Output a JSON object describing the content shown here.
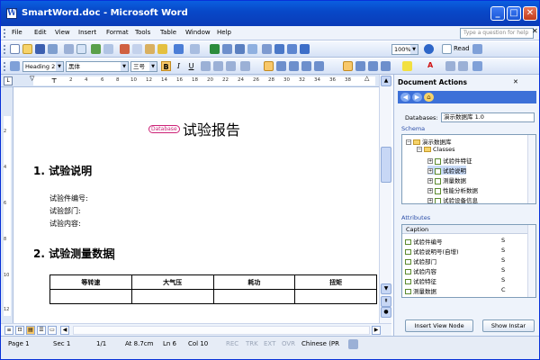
{
  "window": {
    "title": "SmartWord.doc - Microsoft Word",
    "minimize": "_",
    "maximize": "□",
    "close": "✕"
  },
  "menu": {
    "items": [
      "File",
      "Edit",
      "View",
      "Insert",
      "Format",
      "Tools",
      "Table",
      "Window",
      "Help"
    ],
    "help_placeholder": "Type a question for help",
    "close_doc": "✕"
  },
  "toolbar": {
    "zoom": "100%",
    "read_label": "Read",
    "style": "Heading 2",
    "font": "黑体",
    "size": "三号",
    "bold": "B",
    "italic": "I",
    "underline": "U",
    "font_color_letter": "A"
  },
  "ruler": {
    "numbers": [
      "2",
      "4",
      "6",
      "8",
      "10",
      "12",
      "14",
      "16",
      "18",
      "20",
      "22",
      "24",
      "26",
      "28",
      "30",
      "32",
      "34",
      "36",
      "38"
    ],
    "vertical_numbers": [
      "2",
      "4",
      "6",
      "8",
      "10",
      "12"
    ]
  },
  "document": {
    "title_tag": "Database",
    "title": "试验报告",
    "heading1": "1.  试验说明",
    "lines": [
      "试验件编号:",
      "试验部门:",
      "试验内容:"
    ],
    "heading2": "2.  试验测量数据",
    "table_headers": [
      "等转速",
      "大气压",
      "耗功",
      "扭矩"
    ]
  },
  "status": {
    "page": "Page 1",
    "sec": "Sec 1",
    "pages": "1/1",
    "at": "At 8.7cm",
    "ln": "Ln 6",
    "col": "Col 10",
    "rec": "REC",
    "trk": "TRK",
    "ext": "EXT",
    "ovr": "OVR",
    "language": "Chinese (PR"
  },
  "pane": {
    "title": "Document Actions",
    "close": "✕",
    "databases_label": "Databases:",
    "database_value": "演示数据库 1.0",
    "schema_label": "Schema",
    "tree": {
      "root": "演示数据库",
      "classes": "Classes",
      "items": [
        "试验件特征",
        "试验说明",
        "测量数据",
        "性能分析数据",
        "试验设备信息"
      ],
      "selected_index": 1
    },
    "attributes_label": "Attributes",
    "caption_header": "Caption",
    "attributes": [
      {
        "name": "试验件编号",
        "type": "S"
      },
      {
        "name": "试验说明号(自增)",
        "type": "S"
      },
      {
        "name": "试验部门",
        "type": "S"
      },
      {
        "name": "试验内容",
        "type": "S"
      },
      {
        "name": "试验特征",
        "type": "S"
      },
      {
        "name": "测量数据",
        "type": "C"
      }
    ],
    "insert_button": "Insert View Node",
    "show_button": "Show Instar"
  },
  "colors": {
    "titlebar": "#0a5fe0",
    "tag": "#cc2277",
    "highlight": "#f8c86a"
  }
}
